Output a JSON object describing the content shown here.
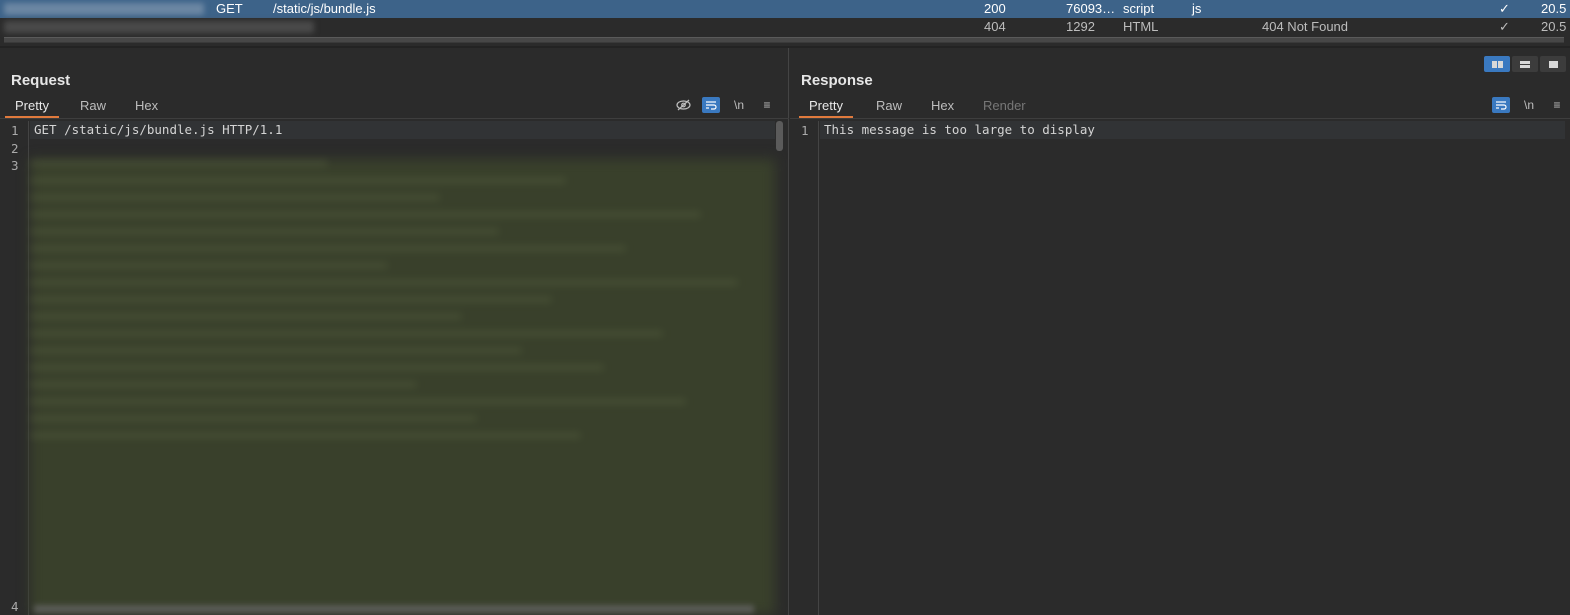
{
  "history": {
    "rows": [
      {
        "method": "GET",
        "url": "/static/js/bundle.js",
        "status": "200",
        "length": "76093…",
        "mime": "script",
        "ext": "js",
        "title": "",
        "check": "✓",
        "time": "20.5"
      },
      {
        "method": "",
        "url": "",
        "status": "404",
        "length": "1292",
        "mime": "HTML",
        "ext": "",
        "title": "404 Not Found",
        "check": "✓",
        "time": "20.5"
      }
    ]
  },
  "request": {
    "title": "Request",
    "tabs": [
      "Pretty",
      "Raw",
      "Hex"
    ],
    "active_tab": "Pretty",
    "tools": {
      "hide_label": "hide",
      "wrap_label": "wrap",
      "newline_label": "\\n",
      "menu_label": "≡"
    },
    "line_numbers": [
      "1",
      "2",
      "3",
      "4"
    ],
    "first_line": "GET /static/js/bundle.js HTTP/1.1"
  },
  "response": {
    "title": "Response",
    "tabs": [
      "Pretty",
      "Raw",
      "Hex",
      "Render"
    ],
    "active_tab": "Pretty",
    "tools": {
      "wrap_label": "wrap",
      "newline_label": "\\n",
      "menu_label": "≡"
    },
    "line_numbers": [
      "1"
    ],
    "first_line": "This message is too large to display"
  },
  "colors": {
    "accent": "#3a79c0",
    "tab_underline": "#e07a3d",
    "selected_row": "#3d6389"
  }
}
